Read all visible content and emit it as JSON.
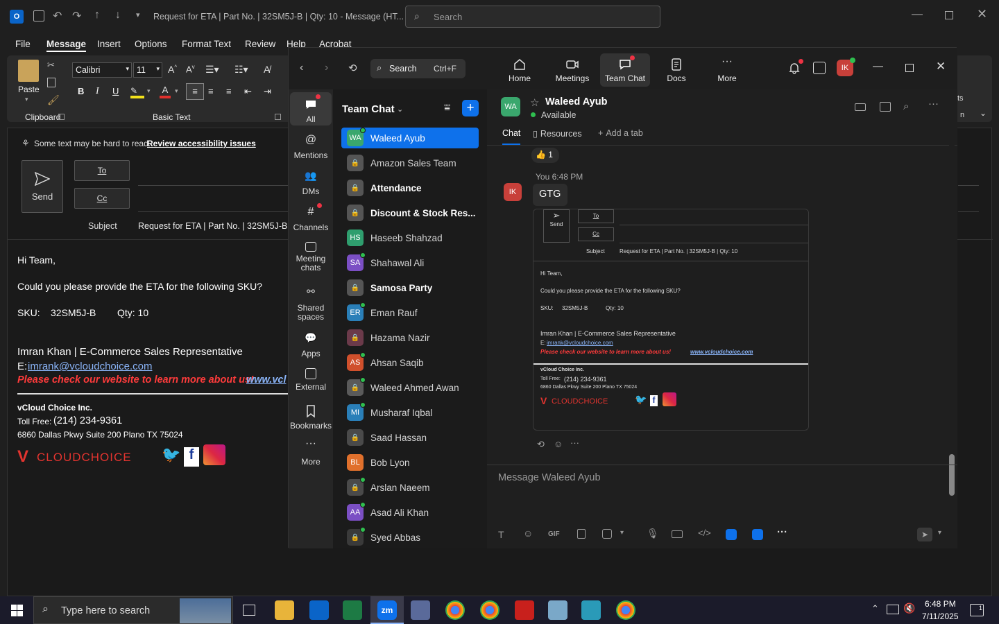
{
  "outlook": {
    "title": "Request for ETA | Part No. | 32SM5J-B | Qty: 10  -  Message (HT...",
    "search_placeholder": "Search",
    "menu": [
      "File",
      "Message",
      "Insert",
      "Options",
      "Format Text",
      "Review",
      "Help",
      "Acrobat"
    ],
    "ribbon": {
      "paste_label": "Paste",
      "clipboard_label": "Clipboard",
      "basic_text_label": "Basic Text",
      "font_name": "Calibri",
      "font_size": "11",
      "side_text_1": "ts",
      "side_text_2": "n"
    },
    "compose": {
      "accessibility_text": "Some text may be hard to read.",
      "accessibility_link": "Review accessibility issues",
      "send_label": "Send",
      "to_label": "To",
      "cc_label": "Cc",
      "subject_label": "Subject",
      "subject_value": "Request for ETA | Part No. | 32SM5J-B | Q"
    },
    "body": {
      "greeting": "Hi Team,",
      "line1": "Could you please provide the ETA for the following SKU?",
      "sku_label": "SKU:",
      "sku_value": "32SM5J-B",
      "qty": "Qty: 10",
      "sig_name": "Imran Khan | E-Commerce Sales Representative",
      "email_prefix": "E: ",
      "email": "imrank@vcloudchoice.com",
      "promo": "Please check our website to learn more about us!",
      "promo_link": "www.vcl",
      "company": "vCloud Choice Inc.",
      "tollfree_label": "Toll Free: ",
      "tollfree_number": "(214) 234-9361",
      "address": "6860 Dallas Pkwy Suite 200 Plano TX 75024",
      "logo_text": "CLOUDCHOICE"
    }
  },
  "zoom": {
    "search_label": "Search",
    "search_shortcut": "Ctrl+F",
    "nav": [
      "Home",
      "Meetings",
      "Team Chat",
      "Docs",
      "More"
    ],
    "avatar_initials": "IK",
    "rail": [
      "All",
      "Mentions",
      "DMs",
      "Channels",
      "Meeting chats",
      "Shared spaces",
      "Apps",
      "External",
      "Bookmarks",
      "More"
    ],
    "list_title": "Team Chat",
    "contacts": [
      {
        "name": "Waleed Ayub",
        "initials": "WA",
        "color": "#3aa76d",
        "selected": true,
        "bold": false,
        "presence": true
      },
      {
        "name": "Amazon Sales Team",
        "initials": "",
        "color": "#555555",
        "selected": false,
        "bold": false,
        "presence": false
      },
      {
        "name": "Attendance",
        "initials": "",
        "color": "#555555",
        "selected": false,
        "bold": true,
        "presence": false
      },
      {
        "name": "Discount & Stock Res...",
        "initials": "",
        "color": "#555555",
        "selected": false,
        "bold": true,
        "presence": false
      },
      {
        "name": "Haseeb Shahzad",
        "initials": "HS",
        "color": "#2f9e6e",
        "selected": false,
        "bold": false,
        "presence": false
      },
      {
        "name": "Shahawal Ali",
        "initials": "SA",
        "color": "#7b4fc4",
        "selected": false,
        "bold": false,
        "presence": true
      },
      {
        "name": "Samosa Party",
        "initials": "",
        "color": "#555555",
        "selected": false,
        "bold": true,
        "presence": false
      },
      {
        "name": "Eman Rauf",
        "initials": "ER",
        "color": "#2a7fb8",
        "selected": false,
        "bold": false,
        "presence": true
      },
      {
        "name": "Hazama Nazir",
        "initials": "",
        "color": "#6b3a4a",
        "selected": false,
        "bold": false,
        "presence": false
      },
      {
        "name": "Ahsan Saqib",
        "initials": "AS",
        "color": "#d0502c",
        "selected": false,
        "bold": false,
        "presence": true
      },
      {
        "name": "Waleed Ahmed Awan",
        "initials": "",
        "color": "#5a5a5a",
        "selected": false,
        "bold": false,
        "presence": true
      },
      {
        "name": "Musharaf Iqbal",
        "initials": "MI",
        "color": "#2a7fb8",
        "selected": false,
        "bold": false,
        "presence": true
      },
      {
        "name": "Saad Hassan",
        "initials": "",
        "color": "#4a4a4a",
        "selected": false,
        "bold": false,
        "presence": false
      },
      {
        "name": "Bob Lyon",
        "initials": "BL",
        "color": "#e0702c",
        "selected": false,
        "bold": false,
        "presence": false
      },
      {
        "name": "Arslan Naeem",
        "initials": "",
        "color": "#4a4a4a",
        "selected": false,
        "bold": false,
        "presence": true
      },
      {
        "name": "Asad Ali Khan",
        "initials": "AA",
        "color": "#7b4fc4",
        "selected": false,
        "bold": false,
        "presence": true
      },
      {
        "name": "Syed Abbas",
        "initials": "",
        "color": "#3a3a3a",
        "selected": false,
        "bold": false,
        "presence": true
      }
    ],
    "chat": {
      "contact_name": "Waleed Ayub",
      "contact_initials": "WA",
      "status": "Available",
      "tabs": [
        "Chat",
        "Resources",
        "Add a tab"
      ],
      "reaction_count": "1",
      "sender_time": "You 6:48 PM",
      "message": "GTG",
      "sender_initials": "IK",
      "input_placeholder": "Message Waleed Ayub",
      "preview": {
        "send": "Send",
        "to": "To",
        "cc": "Cc",
        "subject_label": "Subject",
        "subject_value": "Request for ETA | Part No. | 32SM5J-B | Qty: 10",
        "greeting": "Hi Team,",
        "line1": "Could you please provide the ETA for the following SKU?",
        "sku": "SKU:",
        "sku_value": "32SM5J-B",
        "qty": "Qty: 10",
        "sig_name": "Imran Khan | E-Commerce Sales Representative",
        "email_prefix": "E: ",
        "email": "imrank@vcloudchoice.com",
        "promo": "Please check our website to learn more about us!",
        "promo_link": "www.vcloudchoice.com",
        "company": "vCloud Choice Inc.",
        "tollfree_label": "Toll Free: ",
        "tollfree_number": "(214) 234-9361",
        "address": "6860 Dallas Pkwy Suite 200 Plano TX 75024",
        "logo_text": "CLOUDCHOICE"
      }
    }
  },
  "taskbar": {
    "search_placeholder": "Type here to search",
    "time": "6:48 PM",
    "date": "7/11/2025",
    "notification_count": "1"
  }
}
